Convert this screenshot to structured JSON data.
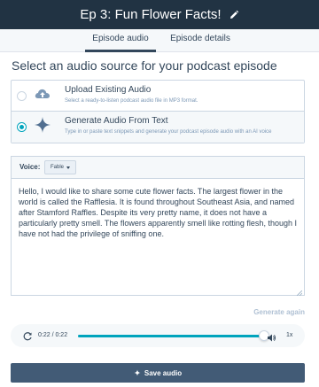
{
  "header": {
    "title": "Ep 3: Fun Flower Facts!",
    "edit_icon": "pencil-icon"
  },
  "tabs": [
    {
      "label": "Episode audio",
      "active": true
    },
    {
      "label": "Episode details",
      "active": false
    }
  ],
  "main": {
    "heading": "Select an audio source for your podcast episode",
    "options": [
      {
        "title": "Upload Existing Audio",
        "description": "Select a ready-to-listen podcast audio file in MP3 format.",
        "icon": "cloud-upload-icon",
        "selected": false
      },
      {
        "title": "Generate Audio From Text",
        "description": "Type in or paste text snippets and generate your podcast episode audio with an AI voice",
        "icon": "sparkle-icon",
        "selected": true
      }
    ],
    "voice": {
      "label": "Voice:",
      "selected": "Fable"
    },
    "text": "Hello, I would like to share some cute flower facts. The largest flower in the world is called the Rafflesia. It is found throughout Southeast Asia, and named after Stamford Raffles. Despite its very pretty name, it does not have a particularly pretty smell. The flowers apparently smell like rotting flesh, though I have not had the privilege of sniffing one.",
    "generate_again_label": "Generate again"
  },
  "player": {
    "time": "0:22 / 0:22",
    "progress": 1.0,
    "speed": "1x"
  },
  "save_button": {
    "label": "Save audio"
  },
  "colors": {
    "header_bg": "#213343",
    "accent": "#00a4bd",
    "button_bg": "#425b76",
    "text": "#33475b"
  }
}
